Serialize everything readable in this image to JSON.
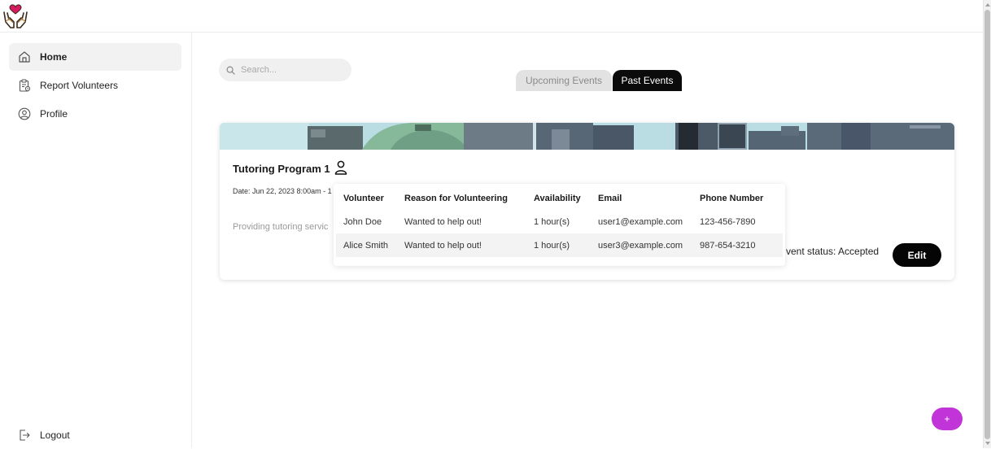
{
  "app": {
    "logo_icon": "hands-heart-icon",
    "accent_color": "#c034d8"
  },
  "sidebar": {
    "items": [
      {
        "label": "Home",
        "icon": "home-icon",
        "active": true
      },
      {
        "label": "Report Volunteers",
        "icon": "clipboard-icon",
        "active": false
      },
      {
        "label": "Profile",
        "icon": "user-circle-icon",
        "active": false
      }
    ],
    "logout_label": "Logout",
    "logout_icon": "logout-icon"
  },
  "search": {
    "placeholder": "Search...",
    "value": ""
  },
  "tabs": [
    {
      "label": "Upcoming Events",
      "active": false
    },
    {
      "label": "Past Events",
      "active": true
    }
  ],
  "event": {
    "title": "Tutoring Program 1",
    "date": "Date: Jun 22, 2023 8:00am - 1",
    "description": "Providing tutoring servic",
    "status": "vent status: Accepted",
    "edit_label": "Edit"
  },
  "volunteers_table": {
    "columns": [
      "Volunteer",
      "Reason for Volunteering",
      "Availability",
      "Email",
      "Phone Number"
    ],
    "rows": [
      [
        "John Doe",
        "Wanted to help out!",
        "1 hour(s)",
        "user1@example.com",
        "123-456-7890"
      ],
      [
        "Alice Smith",
        "Wanted to help out!",
        "1 hour(s)",
        "user3@example.com",
        "987-654-3210"
      ]
    ]
  },
  "fab": {
    "label": "+"
  }
}
